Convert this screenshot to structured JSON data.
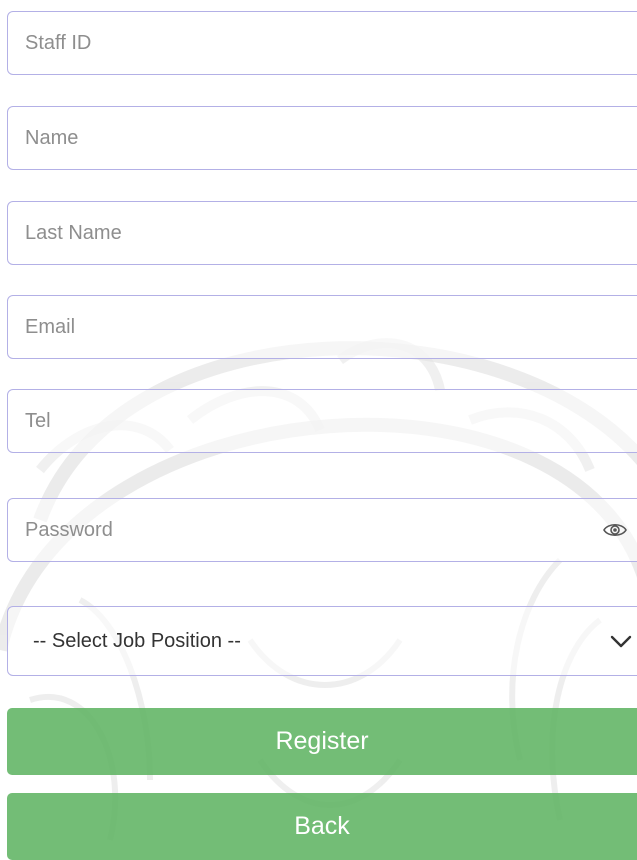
{
  "form": {
    "staff_id_placeholder": "Staff ID",
    "name_placeholder": "Name",
    "last_name_placeholder": "Last Name",
    "email_placeholder": "Email",
    "tel_placeholder": "Tel",
    "password_placeholder": "Password",
    "job_position_selected": "-- Select Job Position --",
    "register_label": "Register",
    "back_label": "Back"
  },
  "icons": {
    "password_toggle": "eye-icon",
    "select_dropdown": "chevron-down-icon"
  },
  "colors": {
    "field_border": "#b3b0e6",
    "button_green": "#5cb260",
    "placeholder_text": "#8e8e8e",
    "watermark": "#d9d9d9"
  }
}
